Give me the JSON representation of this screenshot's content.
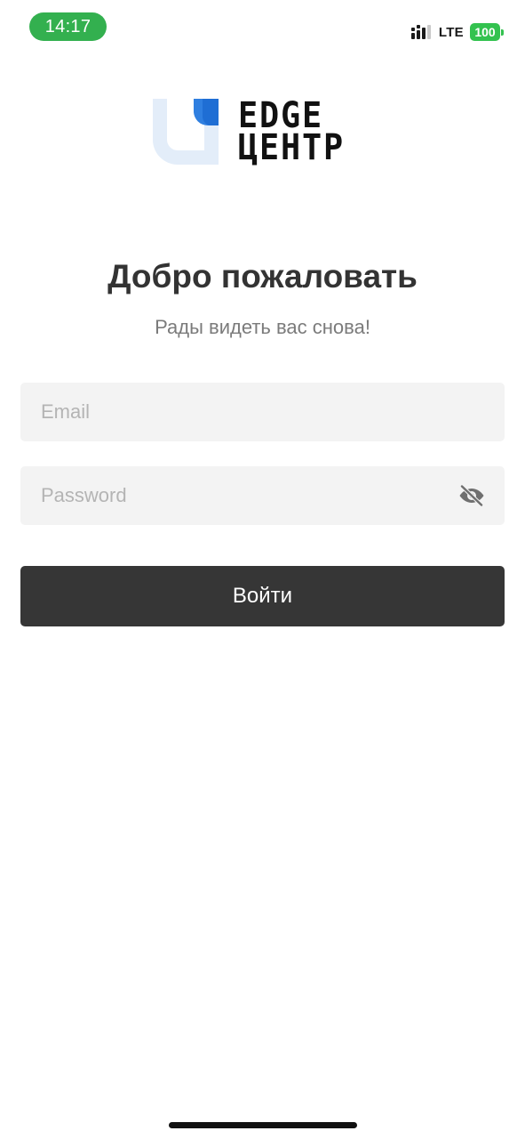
{
  "status_bar": {
    "time": "14:17",
    "network": "LTE",
    "battery": "100",
    "signal_icon": "cellular-signal-icon",
    "colors": {
      "time_pill": "#33b04f",
      "battery": "#33c24f"
    }
  },
  "logo": {
    "line1": "EDGE",
    "line2": "ЦЕНТР",
    "mark_icon": "edge-center-logo-mark",
    "colors": {
      "mark_light": "#e3edf9",
      "mark_accent": "#2f7fe0"
    }
  },
  "welcome": {
    "title": "Добро пожаловать",
    "subtitle": "Рады видеть вас снова!"
  },
  "form": {
    "email": {
      "value": "",
      "placeholder": "Email"
    },
    "password": {
      "value": "",
      "placeholder": "Password",
      "toggle_icon": "eye-off-icon"
    },
    "submit_label": "Войти"
  },
  "theme": {
    "button_bg": "#363636",
    "input_bg": "#f3f3f3"
  }
}
